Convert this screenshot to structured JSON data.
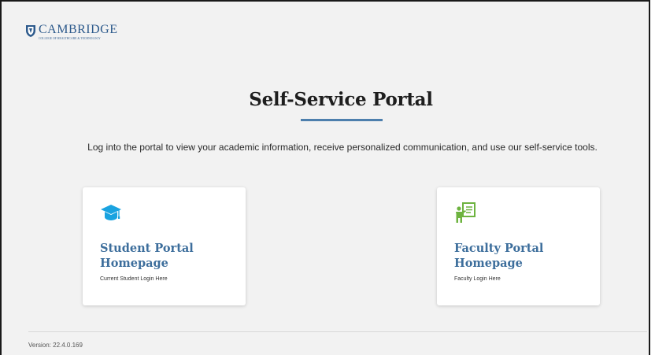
{
  "brand": {
    "name": "CAMBRIDGE",
    "tagline": "COLLEGE OF HEALTHCARE & TECHNOLOGY",
    "color": "#2d5a8c"
  },
  "page": {
    "title": "Self-Service Portal",
    "intro": "Log into the portal to view your academic information, receive personalized communication, and use our self-service tools."
  },
  "cards": {
    "student": {
      "title": "Student Portal\nHomepage",
      "subtitle": "Current Student Login Here",
      "icon": "graduation-cap-icon",
      "icon_color": "#1aa3e0"
    },
    "faculty": {
      "title": "Faculty Portal\nHomepage",
      "subtitle": "Faculty Login Here",
      "icon": "teacher-presentation-icon",
      "icon_color": "#6db33f"
    }
  },
  "footer": {
    "version": "Version: 22.4.0.169"
  },
  "colors": {
    "accent": "#4d7fad",
    "card_title": "#3d6e9c",
    "background": "#f2f2f2"
  }
}
